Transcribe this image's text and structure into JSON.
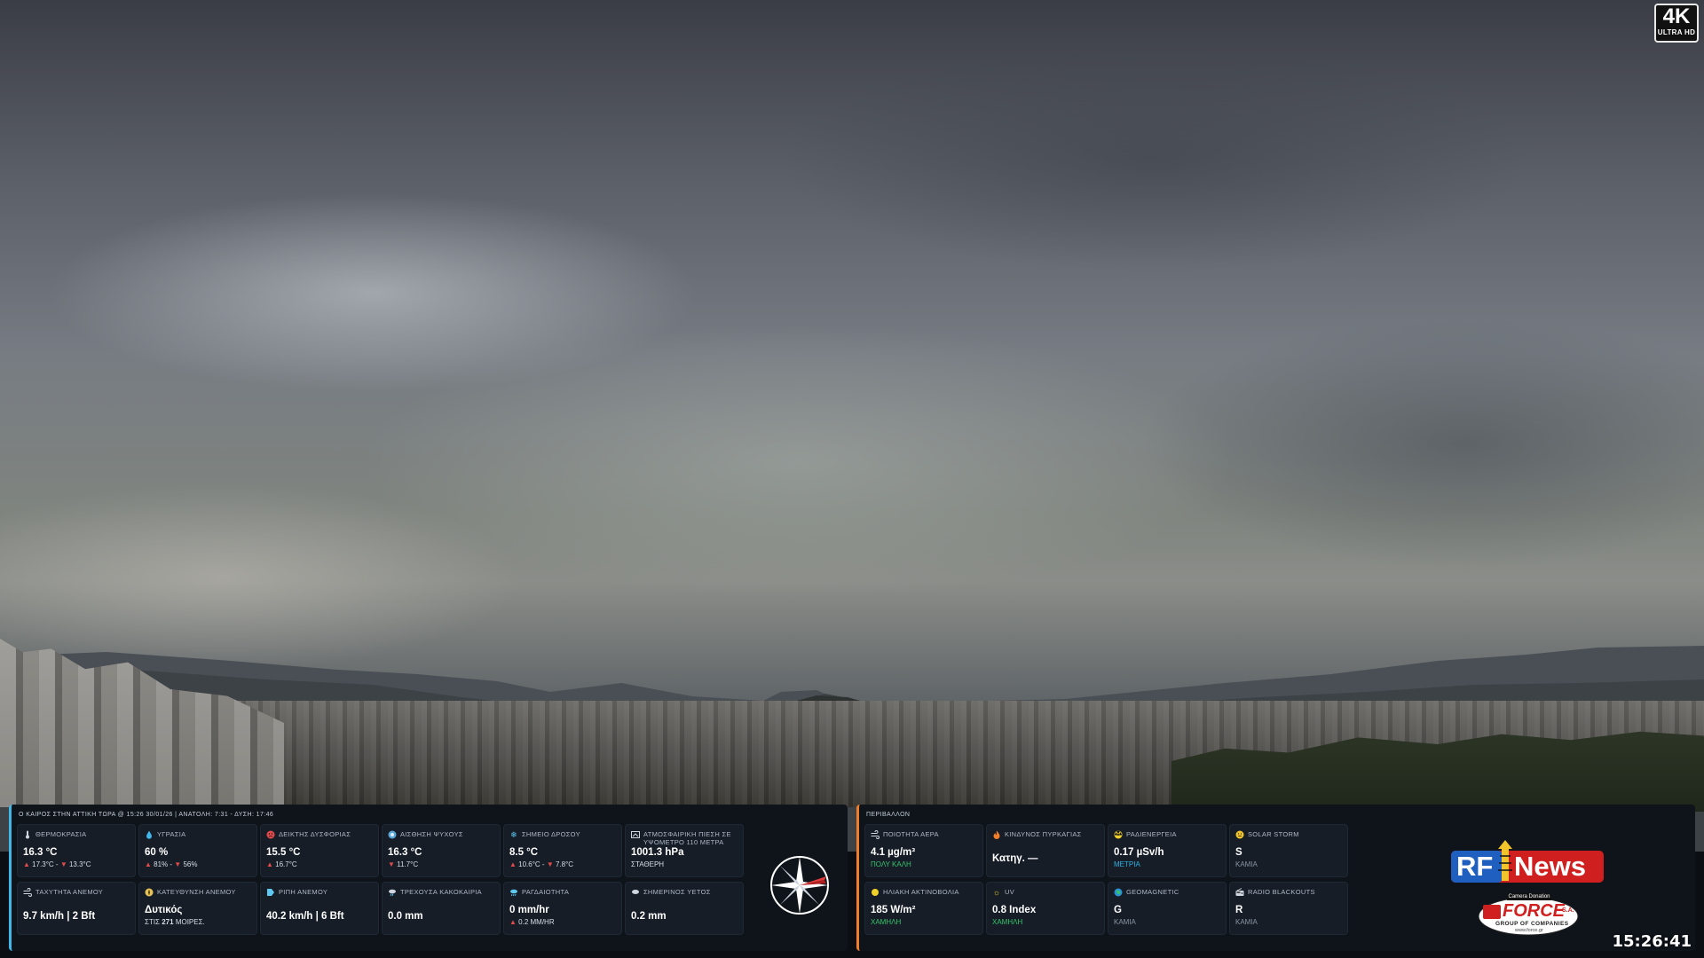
{
  "overlay_badge": {
    "big": "4K",
    "small": "ULTRA HD"
  },
  "weather": {
    "header": "Ο ΚΑΙΡΟΣ ΣΤΗΝ ΑΤΤΙΚΗ ΤΩΡΑ @ 15:26 30/01/26 | ΑΝΑΤΟΛΗ: 7:31 - ΔΥΣΗ: 17:46",
    "cards": [
      {
        "title": "ΘΕΡΜΟΚΡΑΣΙΑ",
        "icon": "thermometer-icon",
        "value": "16.3 °C",
        "sub_up": "17.3°C",
        "sub_sep": " - ",
        "sub_down": "13.3°C"
      },
      {
        "title": "ΥΓΡΑΣΙΑ",
        "icon": "droplet-icon",
        "value": "60 %",
        "sub_up": "81%",
        "sub_sep": " - ",
        "sub_down": "56%"
      },
      {
        "title": "ΔΕΙΚΤΗΣ ΔΥΣΦΟΡΙΑΣ",
        "icon": "discomfort-icon",
        "value": "15.5 °C",
        "sub_up": "16.7°C"
      },
      {
        "title": "ΑΙΣΘΗΣΗ ΨΥΧΟΥΣ",
        "icon": "wind-chill-icon",
        "value": "16.3 °C",
        "sub_down": "11.7°C"
      },
      {
        "title": "ΣΗΜΕΙΟ ΔΡΟΣΟΥ",
        "icon": "snowflake-icon",
        "value": "8.5 °C",
        "sub_up": "10.6°C",
        "sub_sep": " - ",
        "sub_down": "7.8°C"
      },
      {
        "title": "ΑΤΜΟΣΦΑΙΡΙΚΗ ΠΙΕΣΗ ΣΕ ΥΨΟΜΕΤΡΟ 110 ΜΕΤΡΑ",
        "icon": "pressure-icon",
        "value": "1001.3 hPa",
        "sub": "ΣΤΑΘΕΡΗ"
      },
      {
        "title": "ΤΑΧΥΤΗΤΑ ΑΝΕΜΟΥ",
        "icon": "wind-icon",
        "value": "9.7 km/h | 2 Bft"
      },
      {
        "title": "ΚΑΤΕΥΘΥΝΣΗ ΑΝΕΜΟΥ",
        "icon": "wind-direction-icon",
        "value": "Δυτικός",
        "sub_prefix": "ΣΤΙΣ ",
        "sub_bold": "271",
        "sub_suffix": " ΜΟΙΡΕΣ."
      },
      {
        "title": "ΡΙΠΗ ΑΝΕΜΟΥ",
        "icon": "gust-icon",
        "value": "40.2 km/h | 6 Bft"
      },
      {
        "title": "ΤΡΕΧΟΥΣΑ ΚΑΚΟΚΑΙΡΙΑ",
        "icon": "storm-cloud-icon",
        "value": "0.0 mm"
      },
      {
        "title": "ΡΑΓΔΑΙΟΤΗΤΑ",
        "icon": "rain-rate-icon",
        "value": "0 mm/hr",
        "sub_up": "0.2 MM/HR"
      },
      {
        "title": "ΣΗΜΕΡΙΝΟΣ ΥΕΤΟΣ",
        "icon": "rain-cloud-icon",
        "value": "0.2 mm"
      }
    ]
  },
  "environment": {
    "header": "ΠΕΡΙΒΑΛΛΟΝ",
    "cards": [
      {
        "title": "ΠΟΙΟΤΗΤΑ ΑΕΡΑ",
        "icon": "air-quality-icon",
        "value": "4.1 µg/m³",
        "status": "ΠΟΛΥ ΚΑΛΗ",
        "status_color": "#36c46b"
      },
      {
        "title": "ΚΙΝΔΥΝΟΣ ΠΥΡΚΑΓΙΑΣ",
        "icon": "fire-icon",
        "value": "Κατηγ. —",
        "status": "",
        "status_color": "#8a94a1"
      },
      {
        "title": "ΡΑΔΙΕΝΕΡΓΕΙΑ",
        "icon": "radiation-icon",
        "value": "0.17 µSv/h",
        "status": "ΜΕΤΡΙΑ",
        "status_color": "#2bb3e6"
      },
      {
        "title": "SOLAR STORM",
        "icon": "solar-storm-icon",
        "value": "S",
        "status": "ΚΑΜΙΑ",
        "status_color": "#8a94a1"
      },
      {
        "title": "ΗΛΙΑΚΗ ΑΚΤΙΝΟΒΟΛΙΑ",
        "icon": "sun-icon",
        "value": "185 W/m²",
        "status": "ΧΑΜΗΛΗ",
        "status_color": "#36c46b"
      },
      {
        "title": "UV",
        "icon": "uv-icon",
        "value": "0.8 Index",
        "status": "ΧΑΜΗΛΗ",
        "status_color": "#36c46b"
      },
      {
        "title": "GEOMAGNETIC",
        "icon": "globe-icon",
        "value": "G",
        "status": "ΚΑΜΙΑ",
        "status_color": "#8a94a1"
      },
      {
        "title": "RADIO BLACKOUTS",
        "icon": "radio-icon",
        "value": "R",
        "status": "ΚΑΜΙΑ",
        "status_color": "#8a94a1"
      }
    ]
  },
  "logos": {
    "rf_left": "RF",
    "rf_right": "News",
    "force_top": "Camera Donation",
    "force_main": "FORCE",
    "force_sa": "S.A.",
    "force_sub": "GROUP OF COMPANIES",
    "force_url": "www.force.gr"
  },
  "clock": "15:26:41",
  "colors": {
    "weather_accent": "#3fb7e8",
    "environment_accent": "#ef7d2a",
    "panel_bg": "#0f141b",
    "card_bg": "#161d27",
    "trend_red": "#e04b4b"
  }
}
